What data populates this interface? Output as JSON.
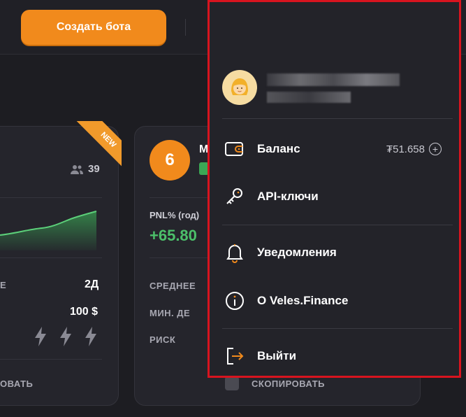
{
  "topbar": {
    "create_bot_label": "Создать бота",
    "icons": [
      "stats-icon",
      "profile-icon",
      "chat-icon",
      "moon-icon",
      "globe-icon"
    ]
  },
  "left_card": {
    "badge": "NEW",
    "followers": "39",
    "row1_label": "Е",
    "row1_value": "2Д",
    "row2_value": "100 $",
    "copy_label": "ОВАТЬ"
  },
  "mid_card": {
    "rank": "6",
    "title_partial": "М",
    "pnl_label": "PNL% (год)",
    "pnl_value": "+65.80",
    "rows": [
      "СРЕДНЕЕ",
      "МИН. ДЕ",
      "РИСК"
    ],
    "copy_label": "СКОПИРОВАТЬ"
  },
  "dropdown": {
    "items": [
      {
        "label": "Баланс",
        "icon": "wallet-icon"
      },
      {
        "label": "API-ключи",
        "icon": "key-icon"
      },
      {
        "label": "Уведомления",
        "icon": "bell-icon"
      },
      {
        "label": "О Veles.Finance",
        "icon": "info-icon"
      },
      {
        "label": "Выйти",
        "icon": "logout-icon"
      }
    ],
    "balance_amount": "₮51.658",
    "balance_add": "+"
  },
  "colors": {
    "accent": "#f18a1c",
    "highlight": "#d8141f",
    "positive": "#3ba855"
  }
}
